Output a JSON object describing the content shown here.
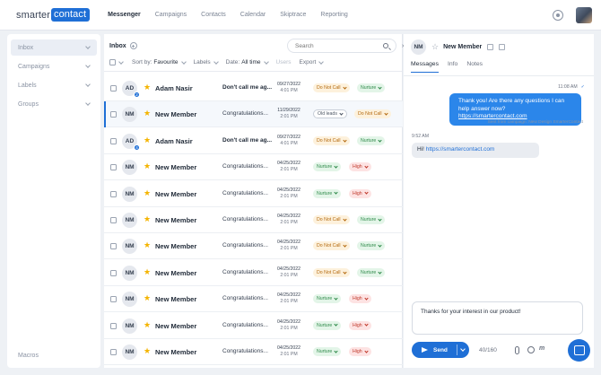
{
  "app": {
    "logo_part1": "smarter",
    "logo_part2": "contact"
  },
  "nav": [
    "Messenger",
    "Campaigns",
    "Contacts",
    "Calendar",
    "Skiptrace",
    "Reporting"
  ],
  "sidebar": {
    "items": [
      "Inbox",
      "Campaigns",
      "Labels",
      "Groups"
    ],
    "footer": "Macros"
  },
  "inbox": {
    "title": "Inbox",
    "search_placeholder": "Search",
    "filters": {
      "sort_label": "Sort by:",
      "sort_value": "Favourite",
      "labels": "Labels",
      "date_label": "Date:",
      "date_value": "All time",
      "users": "Users",
      "export": "Export"
    },
    "rows": [
      {
        "initials": "AD",
        "badge": "2",
        "name": "Adam Nasir",
        "message": "Don't call me ag...",
        "date": "09/27/2022",
        "time": "4:01 PM",
        "unread": true,
        "selected": false,
        "tags": [
          {
            "label": "Do Not Call",
            "kind": "dnc"
          },
          {
            "label": "Nurture",
            "kind": "nurture"
          }
        ]
      },
      {
        "initials": "NM",
        "badge": "",
        "name": "New Member",
        "message": "Congratulations...",
        "date": "11/29/2022",
        "time": "2:01 PM",
        "unread": false,
        "selected": true,
        "tags": [
          {
            "label": "Old leads",
            "kind": "old"
          },
          {
            "label": "Do Not Call",
            "kind": "dnc"
          }
        ]
      },
      {
        "initials": "AD",
        "badge": "4",
        "name": "Adam Nasir",
        "message": "Don't call me ag...",
        "date": "09/27/2022",
        "time": "4:01 PM",
        "unread": true,
        "selected": false,
        "tags": [
          {
            "label": "Do Not Call",
            "kind": "dnc"
          },
          {
            "label": "Nurture",
            "kind": "nurture"
          }
        ]
      },
      {
        "initials": "NM",
        "badge": "",
        "name": "New Member",
        "message": "Congratulations...",
        "date": "04/25/2022",
        "time": "2:01 PM",
        "unread": false,
        "selected": false,
        "tags": [
          {
            "label": "Nurture",
            "kind": "nurture"
          },
          {
            "label": "High",
            "kind": "high"
          }
        ]
      },
      {
        "initials": "NM",
        "badge": "",
        "name": "New Member",
        "message": "Congratulations...",
        "date": "04/25/2022",
        "time": "2:01 PM",
        "unread": false,
        "selected": false,
        "tags": [
          {
            "label": "Nurture",
            "kind": "nurture"
          },
          {
            "label": "High",
            "kind": "high"
          }
        ]
      },
      {
        "initials": "NM",
        "badge": "",
        "name": "New Member",
        "message": "Congratulations...",
        "date": "04/25/2022",
        "time": "2:01 PM",
        "unread": false,
        "selected": false,
        "tags": [
          {
            "label": "Do Not Call",
            "kind": "dnc"
          },
          {
            "label": "Nurture",
            "kind": "nurture"
          }
        ]
      },
      {
        "initials": "NM",
        "badge": "",
        "name": "New Member",
        "message": "Congratulations...",
        "date": "04/25/2022",
        "time": "2:01 PM",
        "unread": false,
        "selected": false,
        "tags": [
          {
            "label": "Do Not Call",
            "kind": "dnc"
          },
          {
            "label": "Nurture",
            "kind": "nurture"
          }
        ]
      },
      {
        "initials": "NM",
        "badge": "",
        "name": "New Member",
        "message": "Congratulations...",
        "date": "04/25/2022",
        "time": "2:01 PM",
        "unread": false,
        "selected": false,
        "tags": [
          {
            "label": "Do Not Call",
            "kind": "dnc"
          },
          {
            "label": "Nurture",
            "kind": "nurture"
          }
        ]
      },
      {
        "initials": "NM",
        "badge": "",
        "name": "New Member",
        "message": "Congratulations...",
        "date": "04/25/2022",
        "time": "2:01 PM",
        "unread": false,
        "selected": false,
        "tags": [
          {
            "label": "Nurture",
            "kind": "nurture"
          },
          {
            "label": "High",
            "kind": "high"
          }
        ]
      },
      {
        "initials": "NM",
        "badge": "",
        "name": "New Member",
        "message": "Congratulations...",
        "date": "04/25/2022",
        "time": "2:01 PM",
        "unread": false,
        "selected": false,
        "tags": [
          {
            "label": "Nurture",
            "kind": "nurture"
          },
          {
            "label": "High",
            "kind": "high"
          }
        ]
      },
      {
        "initials": "NM",
        "badge": "",
        "name": "New Member",
        "message": "Congratulations...",
        "date": "04/25/2022",
        "time": "2:01 PM",
        "unread": false,
        "selected": false,
        "tags": [
          {
            "label": "Nurture",
            "kind": "nurture"
          },
          {
            "label": "High",
            "kind": "high"
          }
        ]
      }
    ]
  },
  "conversation": {
    "initials": "NM",
    "name": "New Member",
    "tabs": [
      "Messages",
      "Info",
      "Notes"
    ],
    "outgoing_time": "11:08 AM",
    "outgoing_text": "Thank you! Are there any questions I can help answer now?",
    "outgoing_link": "https://smartercontact.com",
    "sent_from": "Sent from campaign: New Design SmarterContact",
    "incoming_time": "9:52 AM",
    "incoming_text": "Hi!",
    "incoming_link": "https://smartercontact.com",
    "composer_text": "Thanks for your interest in our product!",
    "send_label": "Send",
    "char_count": "40/160"
  },
  "colors": {
    "accent": "#1f6fd6",
    "tag_dnc": "#b4690e",
    "tag_nurture": "#2f8a4a",
    "tag_high": "#c0392b"
  },
  "icons": {
    "settings": "gear-icon",
    "search": "search-icon",
    "favorite": "star-icon",
    "send": "paper-plane-icon",
    "attach": "paperclip-icon",
    "emoji": "emoji-icon",
    "chat": "chat-icon"
  }
}
